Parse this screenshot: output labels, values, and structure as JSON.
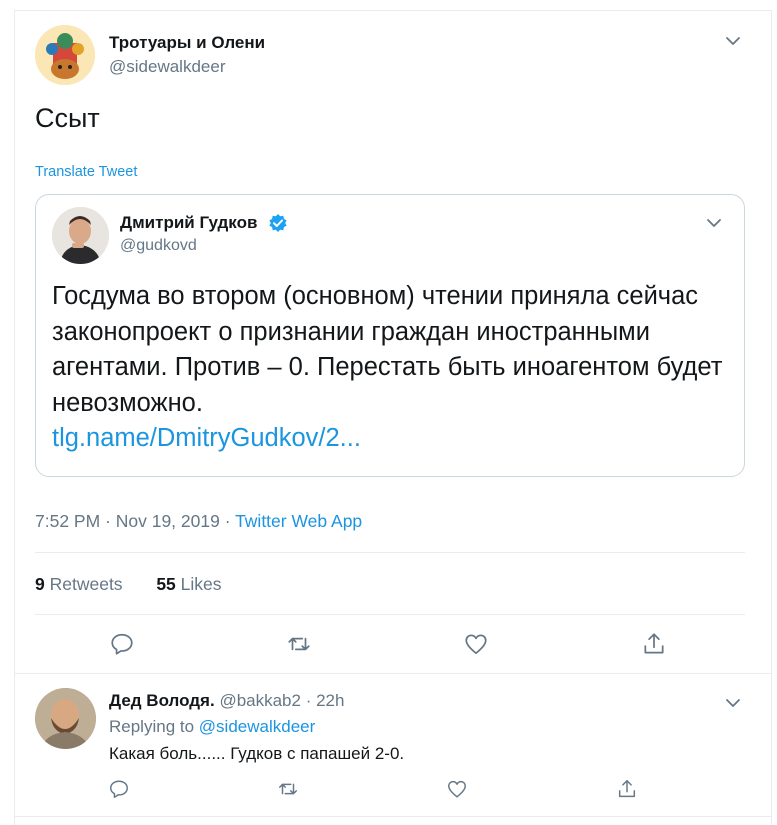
{
  "tweet": {
    "author_name": "Тротуары и Олени",
    "author_handle": "@sidewalkdeer",
    "text": "Ссыт",
    "translate_label": "Translate Tweet",
    "timestamp": "7:52 PM · Nov 19, 2019 · ",
    "source_app": "Twitter Web App",
    "retweets_count": "9",
    "retweets_label": "Retweets",
    "likes_count": "55",
    "likes_label": "Likes"
  },
  "quoted": {
    "author_name": "Дмитрий Гудков",
    "author_handle": "@gudkovd",
    "text": "Госдума во втором (основном) чтении приняла сейчас законопроект о признании граждан иностранными агентами. Против – 0. Перестать быть иноагентом будет невозможно.",
    "link": "tlg.name/DmitryGudkov/2..."
  },
  "reply": {
    "author_name": "Дед Володя.",
    "author_handle": "@bakkab2 · 22h",
    "replying_label": "Replying to ",
    "replying_handle": "@sidewalkdeer",
    "text": "Какая боль...... Гудков с папашей 2-0."
  },
  "icons": {
    "reply": "reply-icon",
    "retweet": "retweet-icon",
    "like": "heart-icon",
    "share": "share-icon",
    "more": "chevron-down-icon",
    "verified": "verified-badge-icon"
  },
  "colors": {
    "accent": "#1b95e0",
    "secondary_text": "#657786",
    "border": "#e6ecf0"
  }
}
